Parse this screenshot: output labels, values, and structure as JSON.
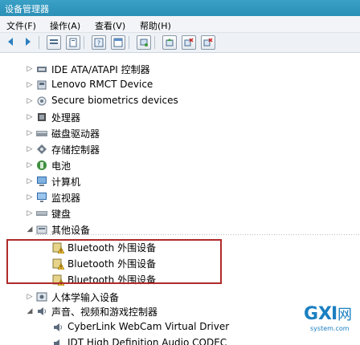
{
  "window": {
    "title": "设备管理器"
  },
  "menu": {
    "file": "文件(F)",
    "action": "操作(A)",
    "view": "查看(V)",
    "help": "帮助(H)"
  },
  "tree": {
    "items": [
      {
        "label": "IDE ATA/ATAPI 控制器",
        "expander": "▷"
      },
      {
        "label": "Lenovo RMCT Device",
        "expander": "▷"
      },
      {
        "label": "Secure biometrics devices",
        "expander": "▷"
      },
      {
        "label": "处理器",
        "expander": "▷"
      },
      {
        "label": "磁盘驱动器",
        "expander": "▷"
      },
      {
        "label": "存储控制器",
        "expander": "▷"
      },
      {
        "label": "电池",
        "expander": "▷"
      },
      {
        "label": "计算机",
        "expander": "▷"
      },
      {
        "label": "监视器",
        "expander": "▷"
      },
      {
        "label": "键盘",
        "expander": "▷"
      },
      {
        "label": "其他设备",
        "expander": "◢"
      },
      {
        "label": "Bluetooth 外围设备",
        "expander": ""
      },
      {
        "label": "Bluetooth 外围设备",
        "expander": ""
      },
      {
        "label": "Bluetooth 外围设备",
        "expander": ""
      },
      {
        "label": "人体学输入设备",
        "expander": "▷"
      },
      {
        "label": "声音、视频和游戏控制器",
        "expander": "◢"
      },
      {
        "label": "CyberLink WebCam Virtual Driver",
        "expander": ""
      },
      {
        "label": "IDT High Definition Audio CODEC",
        "expander": ""
      }
    ]
  },
  "watermark": {
    "brand": "GXI",
    "net": "网",
    "site": "system.com"
  },
  "colors": {
    "titlebar": "#2b8fb6",
    "highlight": "#b02a2a",
    "watermark_blue": "#1b7fc1"
  }
}
